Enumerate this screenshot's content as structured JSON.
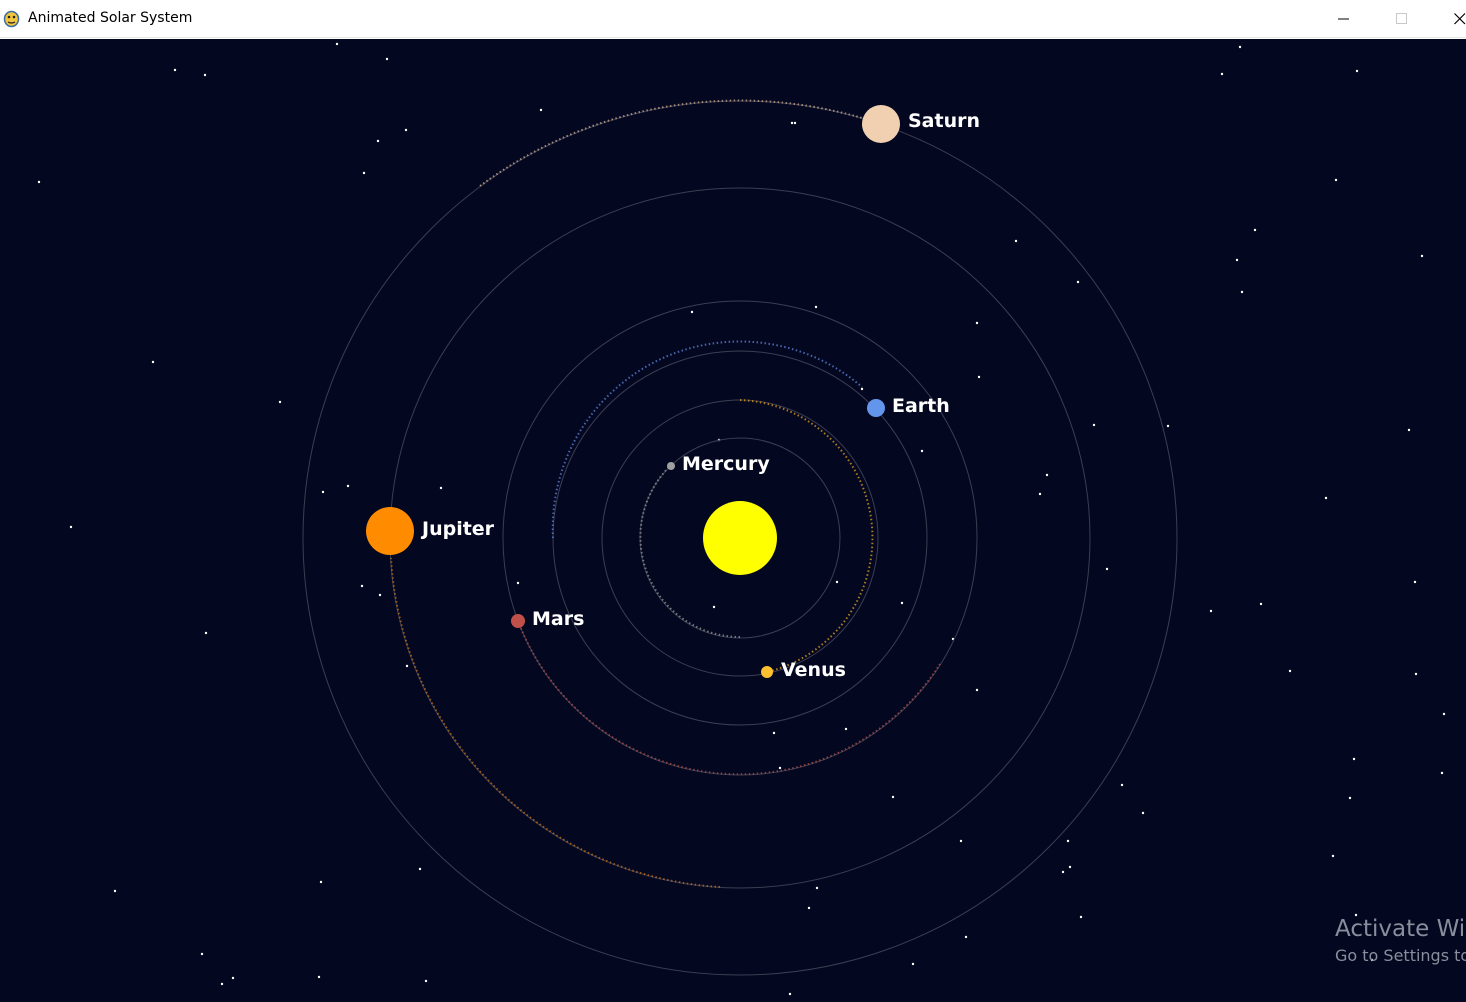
{
  "window": {
    "title": "Animated Solar System",
    "icon": "pygame-snake-icon",
    "controls": [
      "minimize-icon",
      "maximize-icon",
      "close-icon"
    ]
  },
  "scene": {
    "background_color": "#040720",
    "sun_color": "#ffff00",
    "planets": [
      {
        "name": "Mercury",
        "label": "Mercury",
        "color": "#a0a0a0"
      },
      {
        "name": "Venus",
        "label": "Venus",
        "color": "#ffc030"
      },
      {
        "name": "Earth",
        "label": "Earth",
        "color": "#6495ed"
      },
      {
        "name": "Mars",
        "label": "Mars",
        "color": "#c1504b"
      },
      {
        "name": "Jupiter",
        "label": "Jupiter",
        "color": "#ff8c00"
      },
      {
        "name": "Saturn",
        "label": "Saturn",
        "color": "#f0d0b0"
      }
    ]
  },
  "watermark": {
    "line1": "Activate Windows",
    "line2": "Go to Settings to activate Windows."
  }
}
